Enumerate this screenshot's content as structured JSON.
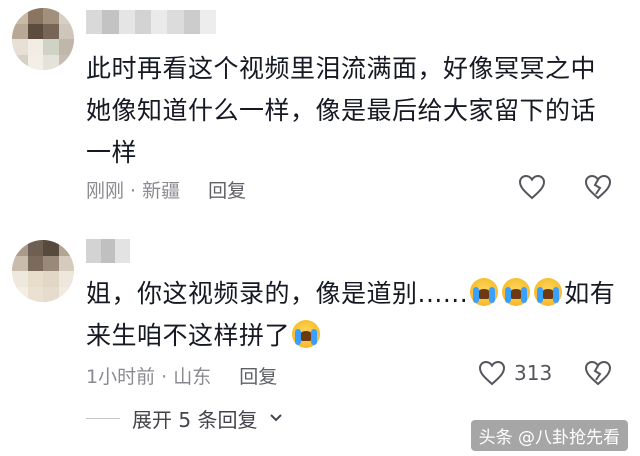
{
  "comments": [
    {
      "text": "此时再看这个视频里泪流满面，好像冥冥之中她像知道什么一样，像是最后给大家留下的话一样",
      "line1": "此时再看这个视频里泪流满面，好像冥冥之中",
      "line2": "她像知道什么一样，像是最后给大家留下的话",
      "line3": "一样",
      "time_location": "刚刚 · 新疆",
      "reply_label": "回复"
    },
    {
      "text_part1": "姐，你这视频录的，像是道别......",
      "text_part2": "如有",
      "text_part3": "来生咱不这样拼了",
      "emoji": "loudly-crying-face",
      "time_location": "1小时前 · 山东",
      "reply_label": "回复",
      "like_count": "313"
    }
  ],
  "expand_replies": "展开 5 条回复",
  "watermark": "头条 @八卦抢先看",
  "colors": {
    "text": "#161823",
    "meta": "#8a8b91",
    "icon": "#55565c"
  }
}
